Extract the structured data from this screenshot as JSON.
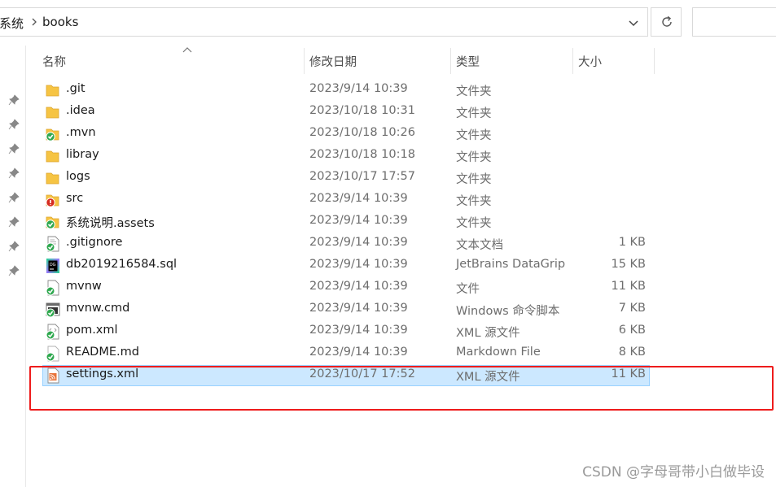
{
  "address_bar": {
    "prev_crumb": "系统",
    "current_crumb": "books"
  },
  "columns": {
    "name": "名称",
    "date": "修改日期",
    "type": "类型",
    "size": "大小"
  },
  "files": [
    {
      "name": ".git",
      "date": "2023/9/14 10:39",
      "type": "文件夹",
      "size": "",
      "icon": "folder-icon"
    },
    {
      "name": ".idea",
      "date": "2023/10/18 10:31",
      "type": "文件夹",
      "size": "",
      "icon": "folder-icon"
    },
    {
      "name": ".mvn",
      "date": "2023/10/18 10:26",
      "type": "文件夹",
      "size": "",
      "icon": "folder-synced-icon"
    },
    {
      "name": "libray",
      "date": "2023/10/18 10:18",
      "type": "文件夹",
      "size": "",
      "icon": "folder-icon"
    },
    {
      "name": "logs",
      "date": "2023/10/17 17:57",
      "type": "文件夹",
      "size": "",
      "icon": "folder-icon"
    },
    {
      "name": "src",
      "date": "2023/9/14 10:39",
      "type": "文件夹",
      "size": "",
      "icon": "folder-modified-icon"
    },
    {
      "name": "系统说明.assets",
      "date": "2023/9/14 10:39",
      "type": "文件夹",
      "size": "",
      "icon": "folder-synced-icon"
    },
    {
      "name": ".gitignore",
      "date": "2023/9/14 10:39",
      "type": "文本文档",
      "size": "1 KB",
      "icon": "text-file-synced-icon"
    },
    {
      "name": "db2019216584.sql",
      "date": "2023/9/14 10:39",
      "type": "JetBrains DataGrip",
      "size": "15 KB",
      "icon": "datagrip-file-icon"
    },
    {
      "name": "mvnw",
      "date": "2023/9/14 10:39",
      "type": "文件",
      "size": "11 KB",
      "icon": "file-synced-icon"
    },
    {
      "name": "mvnw.cmd",
      "date": "2023/9/14 10:39",
      "type": "Windows 命令脚本",
      "size": "7 KB",
      "icon": "cmd-file-synced-icon"
    },
    {
      "name": "pom.xml",
      "date": "2023/9/14 10:39",
      "type": "XML 源文件",
      "size": "6 KB",
      "icon": "xml-file-synced-icon"
    },
    {
      "name": "README.md",
      "date": "2023/9/14 10:39",
      "type": "Markdown File",
      "size": "8 KB",
      "icon": "markdown-file-synced-icon"
    },
    {
      "name": "settings.xml",
      "date": "2023/10/17 17:52",
      "type": "XML 源文件",
      "size": "11 KB",
      "icon": "xml-rss-file-icon",
      "selected": true
    }
  ],
  "watermark": "CSDN @字母哥带小白做毕设",
  "colors": {
    "selection_bg": "#cce8ff",
    "selection_border": "#99d1ff",
    "highlight_box": "#ee1c1c",
    "folder": "#f6c443",
    "sync_green": "#2fa84f",
    "conflict_red": "#d62c1f"
  }
}
